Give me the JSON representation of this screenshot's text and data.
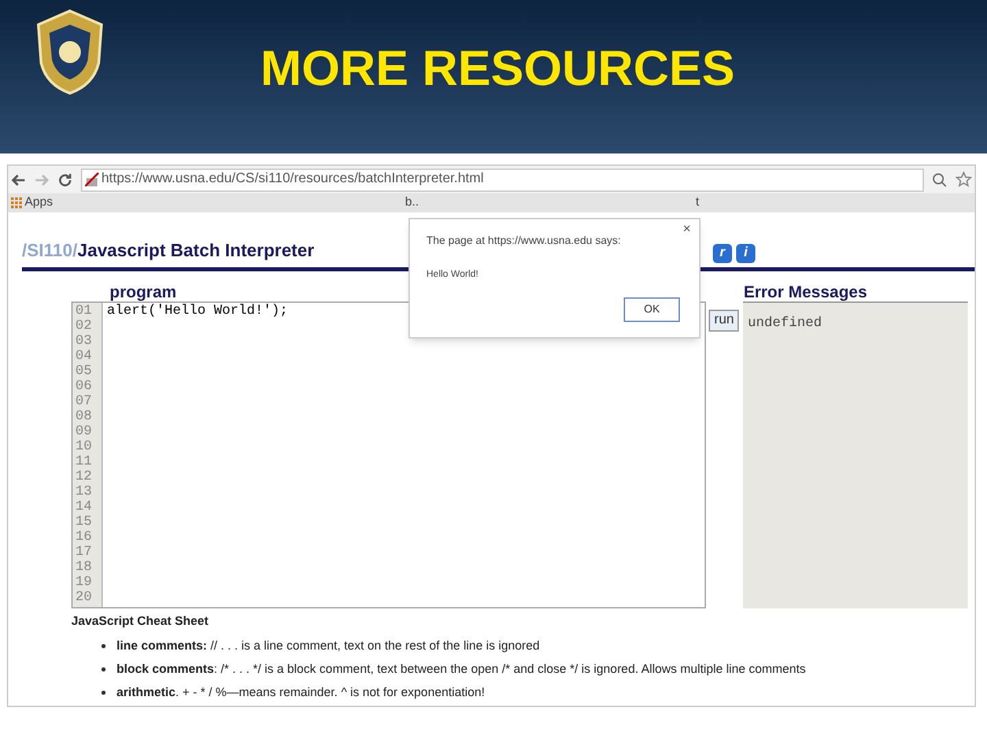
{
  "slide": {
    "title": "MORE RESOURCES"
  },
  "browser": {
    "url": "https://www.usna.edu/CS/si110/resources/batchInterpreter.html",
    "bookmarks": [
      "Apps",
      "b..",
      "t"
    ]
  },
  "page": {
    "title_prefix": "/SI110/",
    "title": "Javascript Batch Interpreter",
    "header_buttons": [
      "r",
      "i"
    ],
    "program_label": "program",
    "line_numbers": [
      "01",
      "02",
      "03",
      "04",
      "05",
      "06",
      "07",
      "08",
      "09",
      "10",
      "11",
      "12",
      "13",
      "14",
      "15",
      "16",
      "17",
      "18",
      "19",
      "20"
    ],
    "code": "alert('Hello World!');",
    "run_button": "run",
    "errors_label": "Error Messages",
    "errors_output": "undefined",
    "cheat_sheet_title": "JavaScript Cheat Sheet",
    "cheat_sheet": [
      {
        "term": "line comments:",
        "text": " // . . . is a line comment, text on the rest of the line is ignored"
      },
      {
        "term": "block comments",
        "text": ": /* . . . */ is a block comment, text between the open /* and close */ is ignored. Allows multiple line comments"
      },
      {
        "term": "arithmetic",
        "text": ". + - * / %—means remainder. ^ is not for exponentiation!"
      }
    ]
  },
  "dialog": {
    "message": "The page at https://www.usna.edu says:",
    "text": "Hello World!",
    "button": "OK",
    "close": "×"
  }
}
